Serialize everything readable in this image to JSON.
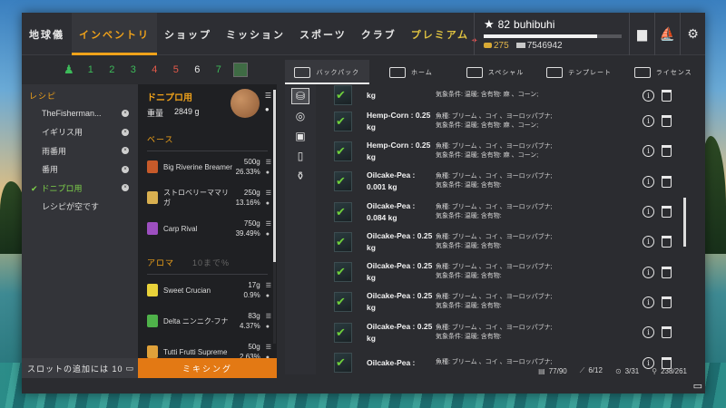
{
  "nav": {
    "items": [
      "地球儀",
      "インベントリ",
      "ショップ",
      "ミッション",
      "スポーツ",
      "クラブ",
      "プレミアム"
    ],
    "active": "インベントリ"
  },
  "profile": {
    "level": "82",
    "username": "buhibuhi",
    "xp_progress": 0.82,
    "gold": "275",
    "silver": "7546942"
  },
  "top_icons": [
    "ranking-icon",
    "boat-icon",
    "gear-icon"
  ],
  "filter": {
    "numbers": [
      "1",
      "2",
      "3",
      "4",
      "5",
      "6",
      "7"
    ],
    "number_colors": [
      "#3dbb5a",
      "#3dbb5a",
      "#3dbb5a",
      "#e55a4a",
      "#e55a4a",
      "#e8e8e8",
      "#3dbb5a"
    ]
  },
  "recipes": {
    "title": "レシピ",
    "items": [
      "TheFisherman...",
      "イギリス用",
      "雨番用",
      "番用",
      "ドニプロ用",
      "レシピが空です"
    ],
    "active_index": 4
  },
  "slot_add": {
    "label": "スロットの追加には 10"
  },
  "detail": {
    "title": "ドニプロ用",
    "weight_label": "重量",
    "weight_value": "2849 g",
    "base_title": "ベース",
    "aroma_title": "アロマ",
    "aroma_hint": "10まで%",
    "base": [
      {
        "name": "Big Riverine Breamer",
        "amount": "500g",
        "percent": "26.33%",
        "color": "#c75a2a"
      },
      {
        "name": "ストロベリーママリガ",
        "amount": "250g",
        "percent": "13.16%",
        "color": "#d9b050"
      },
      {
        "name": "Carp Rival",
        "amount": "750g",
        "percent": "39.49%",
        "color": "#9d4fc0"
      }
    ],
    "aroma": [
      {
        "name": "Sweet Crucian",
        "amount": "17g",
        "percent": "0.9%",
        "color": "#e9d23a"
      },
      {
        "name": "Delta ニンニク-フナ",
        "amount": "83g",
        "percent": "4.37%",
        "color": "#4fb24a"
      },
      {
        "name": "Tutti Frutti Supreme",
        "amount": "50g",
        "percent": "2.63%",
        "color": "#e0a13a"
      }
    ]
  },
  "mix_button": {
    "label": "ミキシング"
  },
  "tabs": {
    "items": [
      "バックパック",
      "ホーム",
      "スペシャル",
      "テンプレート",
      "ライセンス"
    ],
    "active": "バックパック"
  },
  "side_icons": [
    "bait-bag-icon",
    "boilie-icon",
    "bucket-icon",
    "jar-icon",
    "bottle-icon"
  ],
  "items": [
    {
      "name": "kg",
      "desc1": "気象条件: 温暖; 含有物: 麻 、コーン;",
      "desc2": ""
    },
    {
      "name": "Hemp-Corn : 0.25 kg",
      "desc1": "魚種: ブリーム 、コイ 、ヨーロッパブナ;",
      "desc2": "気象条件: 温暖; 含有物: 麻 、コーン;"
    },
    {
      "name": "Hemp-Corn : 0.25 kg",
      "desc1": "魚種: ブリーム 、コイ 、ヨーロッパブナ;",
      "desc2": "気象条件: 温暖; 含有物: 麻 、コーン;"
    },
    {
      "name": "Oilcake-Pea : 0.001 kg",
      "desc1": "魚種: ブリーム 、コイ 、ヨーロッパブナ;",
      "desc2": "気象条件: 温暖; 含有物:"
    },
    {
      "name": "Oilcake-Pea : 0.084 kg",
      "desc1": "魚種: ブリーム 、コイ 、ヨーロッパブナ;",
      "desc2": "気象条件: 温暖; 含有物:"
    },
    {
      "name": "Oilcake-Pea : 0.25 kg",
      "desc1": "魚種: ブリーム 、コイ 、ヨーロッパブナ;",
      "desc2": "気象条件: 温暖; 含有物:"
    },
    {
      "name": "Oilcake-Pea : 0.25 kg",
      "desc1": "魚種: ブリーム 、コイ 、ヨーロッパブナ;",
      "desc2": "気象条件: 温暖; 含有物:"
    },
    {
      "name": "Oilcake-Pea : 0.25 kg",
      "desc1": "魚種: ブリーム 、コイ 、ヨーロッパブナ;",
      "desc2": "気象条件: 温暖; 含有物:"
    },
    {
      "name": "Oilcake-Pea : 0.25 kg",
      "desc1": "魚種: ブリーム 、コイ 、ヨーロッパブナ;",
      "desc2": "気象条件: 温暖; 含有物:"
    },
    {
      "name": "Oilcake-Pea :",
      "desc1": "魚種: ブリーム 、コイ 、ヨーロッパブナ;",
      "desc2": ""
    }
  ],
  "status": {
    "storage": "77/90",
    "rods": "6/12",
    "reels": "3/31",
    "baits": "238/261"
  }
}
